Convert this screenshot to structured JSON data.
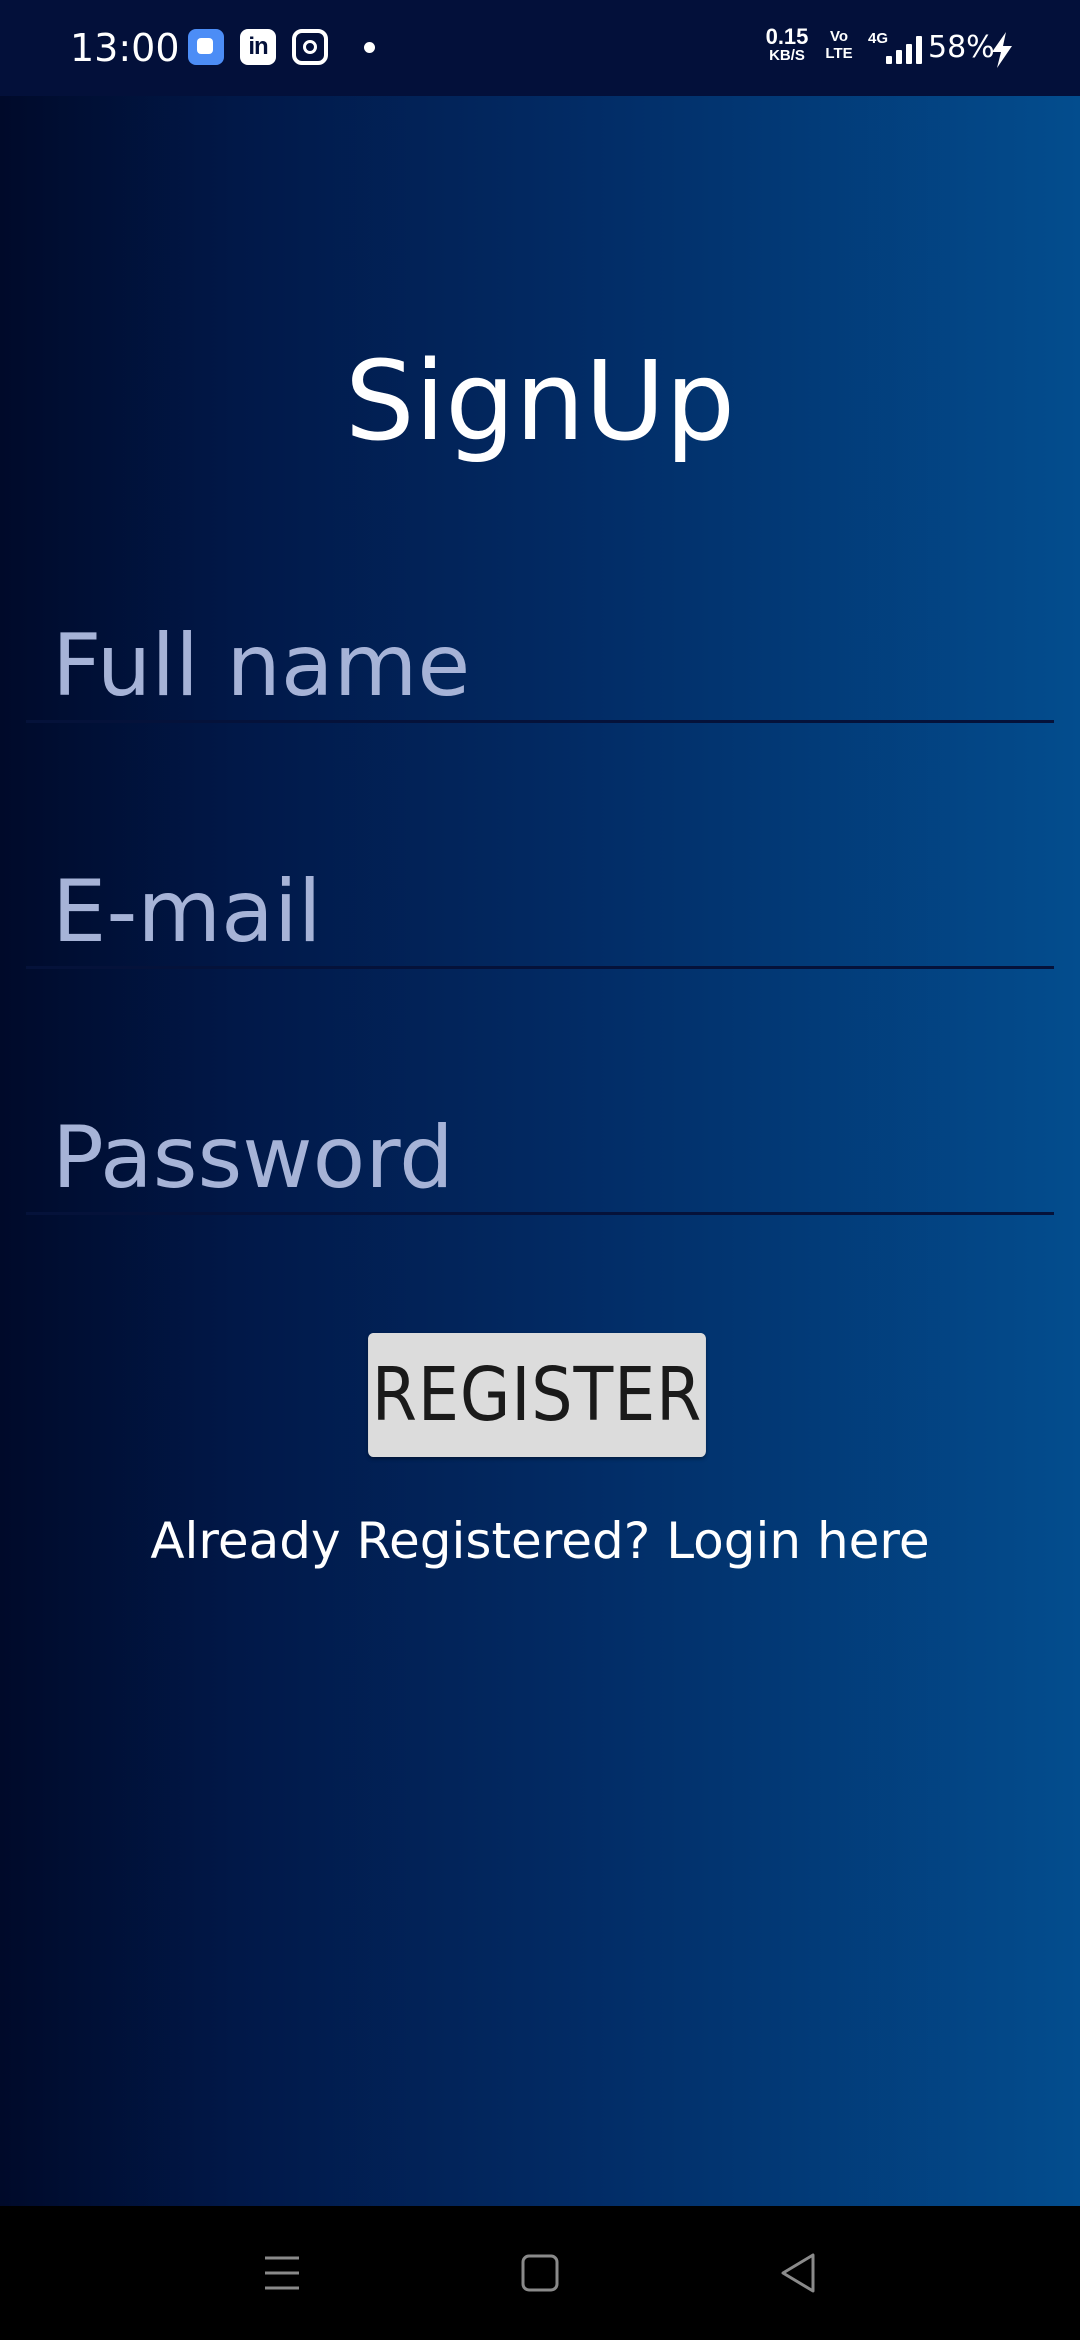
{
  "status_bar": {
    "time": "13:00",
    "notification_icons": [
      "app-icon",
      "linkedin-icon",
      "instagram-icon",
      "dot-icon"
    ],
    "linkedin_glyph": "in",
    "network_speed_value": "0.15",
    "network_speed_unit": "KB/S",
    "volte_top": "Vo",
    "volte_bottom": "LTE",
    "network_type": "4G",
    "battery": "58%",
    "charging": true
  },
  "signup": {
    "title": "SignUp",
    "full_name_placeholder": "Full name",
    "email_placeholder": "E-mail",
    "password_placeholder": "Password",
    "register_label": "REGISTER",
    "login_link": "Already Registered? Login here"
  },
  "nav_bar": {
    "buttons": [
      "menu-icon",
      "home-icon",
      "back-icon"
    ]
  },
  "colors": {
    "status_bar_bg": "#03103a",
    "gradient_left": "#000a2a",
    "gradient_right": "#034d8e",
    "placeholder": "#a6b3d7",
    "button_bg": "#dcdcdc",
    "nav_bar_bg": "#000000"
  }
}
